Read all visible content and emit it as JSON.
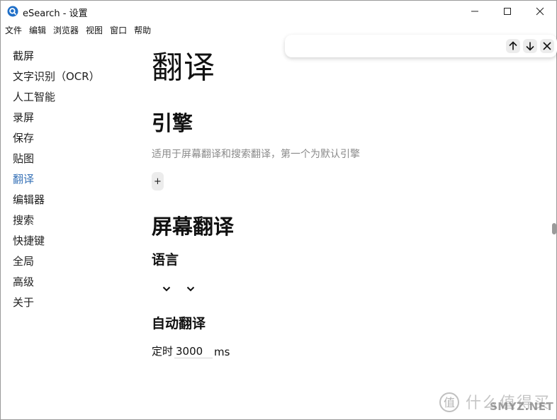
{
  "window": {
    "title": "eSearch - 设置",
    "icons": {
      "app": "search-app-icon",
      "minimize": "minimize-icon",
      "maximize": "maximize-icon",
      "close": "close-icon"
    }
  },
  "menu": [
    "文件",
    "编辑",
    "浏览器",
    "视图",
    "窗口",
    "帮助"
  ],
  "sidebar": {
    "active_index": 6,
    "items": [
      {
        "label": "截屏"
      },
      {
        "label": "文字识别（OCR）"
      },
      {
        "label": "人工智能"
      },
      {
        "label": "录屏"
      },
      {
        "label": "保存"
      },
      {
        "label": "贴图"
      },
      {
        "label": "翻译"
      },
      {
        "label": "编辑器"
      },
      {
        "label": "搜索"
      },
      {
        "label": "快捷键"
      },
      {
        "label": "全局"
      },
      {
        "label": "高级"
      },
      {
        "label": "关于"
      }
    ]
  },
  "main": {
    "page_title": "翻译",
    "engine": {
      "heading": "引擎",
      "description": "适用于屏幕翻译和搜索翻译，第一个为默认引擎",
      "add_label": "+"
    },
    "screen_translate": {
      "heading": "屏幕翻译",
      "language": {
        "heading": "语言",
        "selects": [
          "chevron-down-icon",
          "chevron-down-icon"
        ]
      },
      "auto_translate": {
        "heading": "自动翻译",
        "timer_label": "定时",
        "timer_value": "3000",
        "timer_unit": "ms"
      }
    }
  },
  "search_panel": {
    "icons": [
      "arrow-up-icon",
      "arrow-down-icon",
      "close-icon"
    ]
  },
  "watermark": {
    "text_cn": "什么值得买",
    "text_en": "SMYZ.NET"
  },
  "colors": {
    "accent": "#3a74b8",
    "muted": "#8a8a8a"
  }
}
